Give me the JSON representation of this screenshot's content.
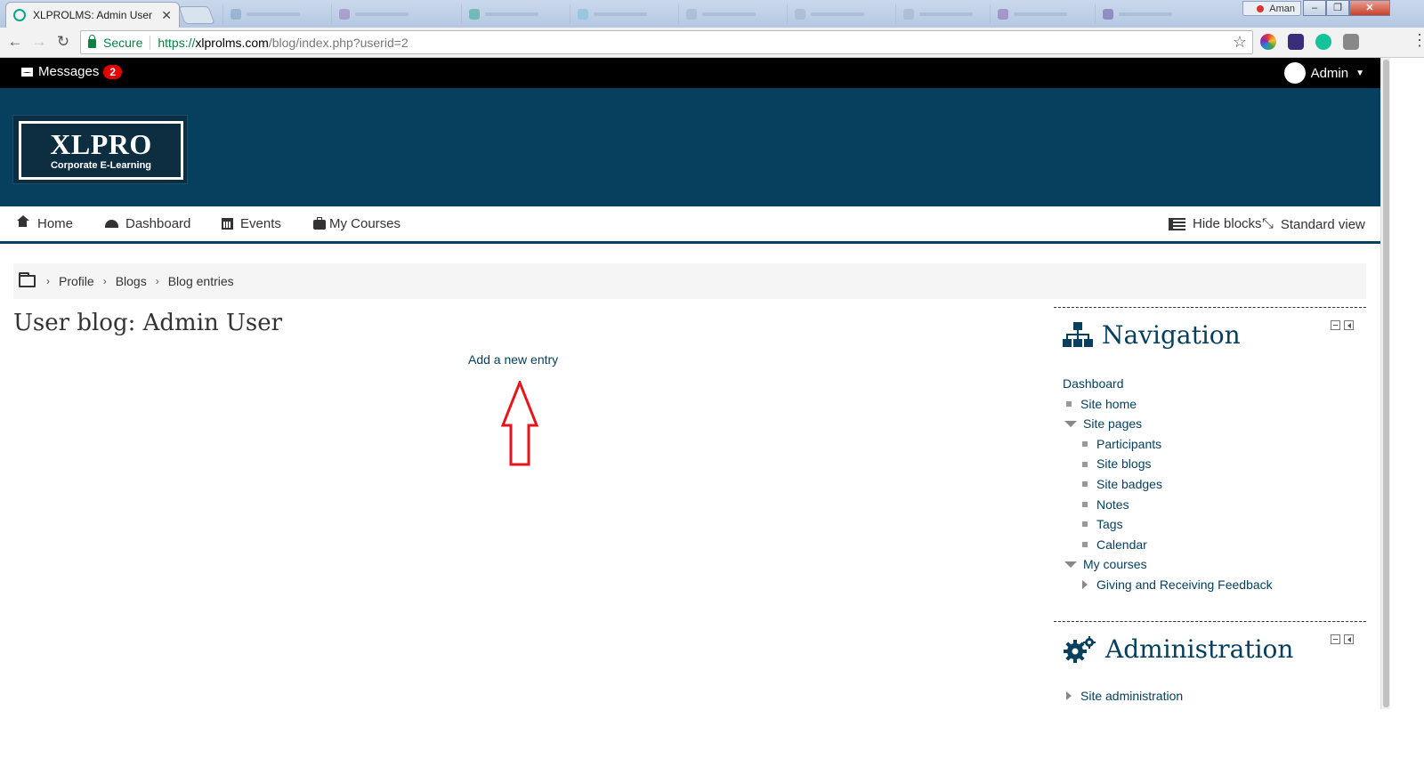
{
  "browser": {
    "tab_title": "XLPROLMS: Admin User",
    "tab_close": "✕",
    "address": {
      "secure_label": "Secure",
      "url_scheme": "https://",
      "url_host": "xlprolms.com",
      "url_path": "/blog/index.php?userid=2"
    },
    "os_user": "Aman",
    "window_buttons": [
      "–",
      "❐",
      "✕"
    ]
  },
  "topbar": {
    "messages_label": "Messages",
    "messages_count": "2",
    "user_name": "Admin"
  },
  "logo": {
    "title": "XLPRO",
    "subtitle": "Corporate E-Learning"
  },
  "main_nav": {
    "items": [
      "Home",
      "Dashboard",
      "Events",
      "My Courses"
    ],
    "hide_blocks": "Hide blocks",
    "standard_view": "Standard view"
  },
  "breadcrumb": {
    "items": [
      "Profile",
      "Blogs"
    ],
    "current": "Blog entries"
  },
  "page": {
    "title": "User blog: Admin User",
    "add_entry": "Add a new entry"
  },
  "navigation_block": {
    "title": "Navigation",
    "dashboard": "Dashboard",
    "site_home": "Site home",
    "site_pages": "Site pages",
    "site_pages_items": [
      "Participants",
      "Site blogs",
      "Site badges",
      "Notes",
      "Tags",
      "Calendar"
    ],
    "my_courses": "My courses",
    "course_1": "Giving and Receiving Feedback"
  },
  "admin_block": {
    "title": "Administration",
    "site_admin": "Site administration"
  },
  "colors": {
    "brand": "#06405e",
    "topbar": "#000000",
    "badge": "#e30000",
    "annotation_arrow": "#e8141b"
  }
}
